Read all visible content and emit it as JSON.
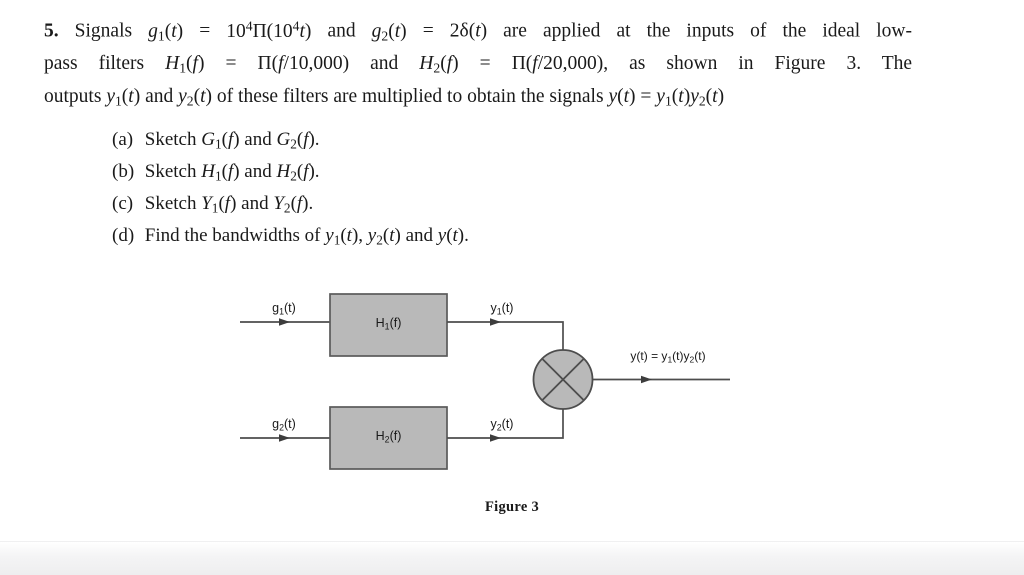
{
  "document": {
    "question_number": "5.",
    "statement": {
      "line1": {
        "lead": "Signals",
        "g1": "g₁(t)",
        "eq1": "=",
        "expr1": "10⁴Π(10⁴t)",
        "and1": "and",
        "g2": "g₂(t)",
        "eq2": "=",
        "expr2": "2δ(t)",
        "tail": "are applied at the inputs of the ideal low-"
      },
      "line2": {
        "lead": "pass  filters",
        "h1": "H₁(f)",
        "eq1": "=",
        "expr1": "Π(f/10,000)",
        "and1": "and",
        "h2": "H₂(f)",
        "eq2": "=",
        "expr2": "Π(f/20,000),",
        "tail": "as  shown  in  Figure  3.  The"
      },
      "line3": {
        "lead": "outputs",
        "y1": "y₁(t)",
        "and1": "and",
        "y2": "y₂(t)",
        "mid": "of these filters are multiplied to obtain the signals",
        "y": "y(t)",
        "eq": "=",
        "product": "y₁(t)y₂(t)"
      },
      "full_text": "5. Signals g1(t) = 10^4 Π(10^4 t) and g2(t) = 2δ(t) are applied at the inputs of the ideal low-pass filters H1(f) = Π(f/10,000) and H2(f) = Π(f/20,000), as shown in Figure 3. The outputs y1(t) and y2(t) of these filters are multiplied to obtain the signals y(t) = y1(t)y2(t)"
    },
    "subquestions": [
      {
        "label": "(a)",
        "text_pre": "Sketch",
        "item1": "G₁(f)",
        "conj": "and",
        "item2": "G₂(f).",
        "full": "(a) Sketch G1(f) and G2(f)."
      },
      {
        "label": "(b)",
        "text_pre": "Sketch",
        "item1": "H₁(f)",
        "conj": "and",
        "item2": "H₂(f).",
        "full": "(b) Sketch H1(f) and H2(f)."
      },
      {
        "label": "(c)",
        "text_pre": "Sketch",
        "item1": "Y₁(f)",
        "conj": "and",
        "item2": "Y₂(f).",
        "full": "(c) Sketch Y1(f) and Y2(f)."
      },
      {
        "label": "(d)",
        "text_pre": "Find the bandwidths of",
        "item1": "y₁(t),",
        "conj": "y₂(t)",
        "item2": "and y(t).",
        "full": "(d) Find the bandwidths of y1(t), y2(t) and y(t)."
      }
    ],
    "figure": {
      "caption": "Figure 3",
      "blocks": [
        {
          "id": "filter-1",
          "label": "H₁(f)",
          "input_label": "g₁(t)",
          "output_label": "y₁(t)"
        },
        {
          "id": "filter-2",
          "label": "H₂(f)",
          "input_label": "g₂(t)",
          "output_label": "y₂(t)"
        }
      ],
      "multiplier": {
        "id": "multiplier",
        "symbol": "X",
        "output_label": "y(t) = y₁(t)y₂(t)"
      },
      "colors": {
        "block_fill": "#b9b9b9",
        "block_stroke": "#5a5a5a",
        "wire": "#4d4d4d",
        "text": "#1a1a1a"
      }
    }
  }
}
